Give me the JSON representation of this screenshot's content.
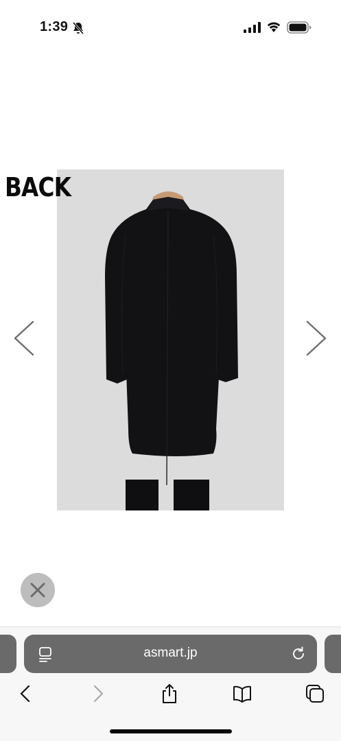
{
  "status_bar": {
    "time": "1:39",
    "icons": [
      "bell-slash-icon",
      "cellular-signal-icon",
      "wifi-icon",
      "battery-icon"
    ]
  },
  "content": {
    "image_label": "BACK",
    "product_image": "black-long-coat-back-view-photo",
    "prev_icon": "chevron-left-icon",
    "next_icon": "chevron-right-icon",
    "close_icon": "close-icon"
  },
  "browser": {
    "url": "asmart.jp",
    "page_menu_icon": "page-menu-icon",
    "reload_icon": "reload-icon",
    "nav": [
      "back-icon",
      "forward-icon",
      "share-icon",
      "bookmarks-icon",
      "tabs-icon"
    ]
  },
  "colors": {
    "url_bar": "#6a6a6a",
    "toolbar_bg": "#f7f7f7",
    "close_button": "#bdbdbd",
    "image_bg": "#dcdcdd",
    "coat": "#121114"
  }
}
